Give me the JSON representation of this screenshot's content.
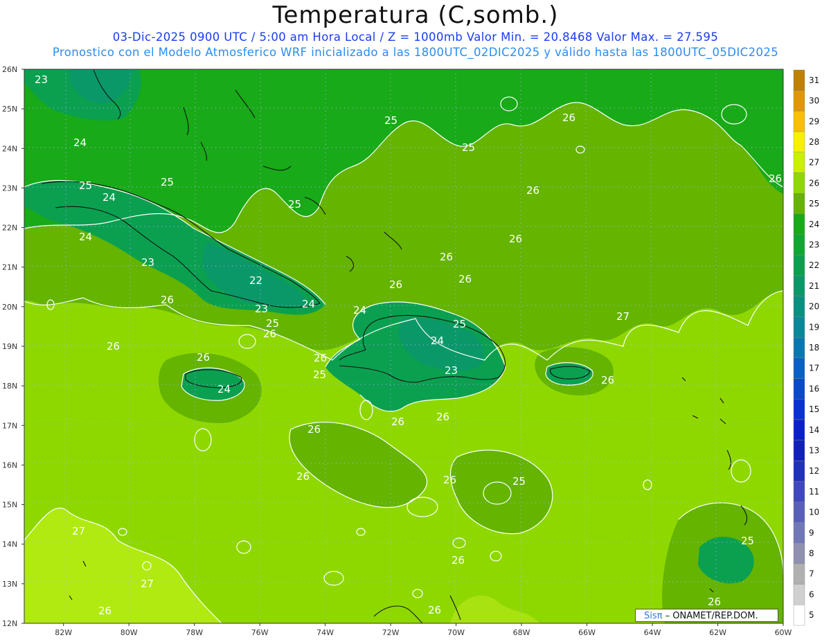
{
  "header": {
    "title": "Temperatura (C,somb.)",
    "subtitle_line1": "03-Dic-2025  0900 UTC / 5:00 am Hora Local / Z = 1000mb    Valor Min. = 20.8468  Valor Max. = 27.595",
    "subtitle_line2": "Pronostico con el Modelo Atmosferico WRF inicializado a las 1800UTC_02DIC2025 y válido hasta las  1800UTC_05DIC2025"
  },
  "credit": {
    "brand": "Sisπ",
    "text": " – ONAMET/REP.DOM."
  },
  "map": {
    "lat_labels": [
      "12N",
      "13N",
      "14N",
      "15N",
      "16N",
      "17N",
      "18N",
      "19N",
      "20N",
      "21N",
      "22N",
      "23N",
      "24N",
      "25N",
      "26N"
    ],
    "lon_labels": [
      "82W",
      "80W",
      "78W",
      "76W",
      "74W",
      "72W",
      "70W",
      "68W",
      "66W",
      "64W",
      "62W",
      "60W"
    ],
    "lat_range": [
      12,
      26
    ],
    "lon_range": [
      -83.2,
      -60
    ],
    "contour_labels": [
      "23",
      "24",
      "25",
      "25",
      "24",
      "23",
      "24",
      "25",
      "25",
      "25",
      "26",
      "26",
      "22",
      "23",
      "24",
      "25",
      "26",
      "26",
      "26",
      "26",
      "24",
      "25",
      "24",
      "23",
      "25",
      "26",
      "26",
      "26",
      "26",
      "24",
      "26",
      "26",
      "26",
      "25",
      "26",
      "26",
      "26",
      "26",
      "26",
      "27",
      "27",
      "27",
      "26",
      "26",
      "25",
      "26",
      "26"
    ]
  },
  "colorbar": {
    "labels": [
      "31",
      "30",
      "29",
      "28",
      "27",
      "26",
      "25",
      "24",
      "23",
      "22",
      "21",
      "20",
      "19",
      "18",
      "17",
      "16",
      "15",
      "14",
      "13",
      "12",
      "11",
      "10",
      "9",
      "8",
      "7",
      "6",
      "5"
    ],
    "colors": [
      "#c08000",
      "#e09800",
      "#f8c000",
      "#f8f000",
      "#c8f000",
      "#8ed800",
      "#64b400",
      "#18aa18",
      "#10a830",
      "#0aa050",
      "#0a9868",
      "#089080",
      "#088898",
      "#0a78b0",
      "#0a60c8",
      "#0a48d0",
      "#0a30d8",
      "#0a20d0",
      "#1020c0",
      "#2030c0",
      "#4048c0",
      "#5860b8",
      "#7078b8",
      "#9090b0",
      "#b0b0b0",
      "#d0d0d0",
      "#ffffff"
    ]
  },
  "legend_lines": [
    "#ffffff"
  ]
}
